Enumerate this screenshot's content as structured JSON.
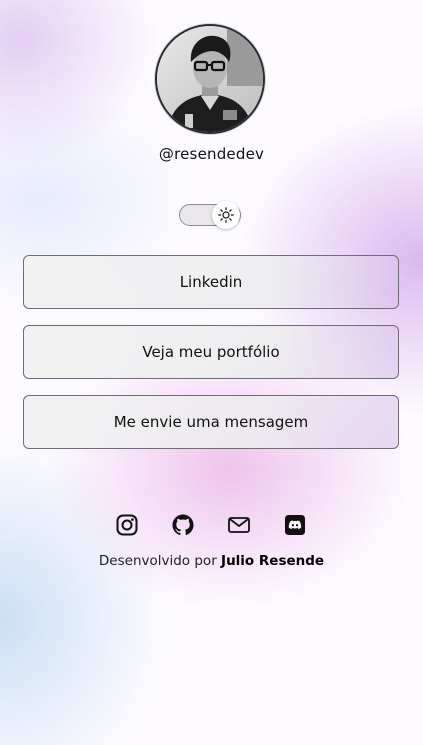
{
  "profile": {
    "username": "@resendedev",
    "avatar_icon": "profile-photo"
  },
  "theme_toggle": {
    "mode": "light",
    "icon": "sun-icon"
  },
  "links": [
    {
      "label": "Linkedin"
    },
    {
      "label": "Veja meu portfólio"
    },
    {
      "label": "Me envie uma mensagem"
    }
  ],
  "socials": [
    {
      "name": "instagram-icon"
    },
    {
      "name": "github-icon"
    },
    {
      "name": "mail-icon"
    },
    {
      "name": "discord-icon"
    }
  ],
  "footer": {
    "prefix": "Desenvolvido por",
    "author": "Julio Resende"
  },
  "colors": {
    "button_border": "#6f6c73",
    "text": "#111111",
    "accent_purple": "#c896e6",
    "accent_blue": "#aacdf0"
  }
}
